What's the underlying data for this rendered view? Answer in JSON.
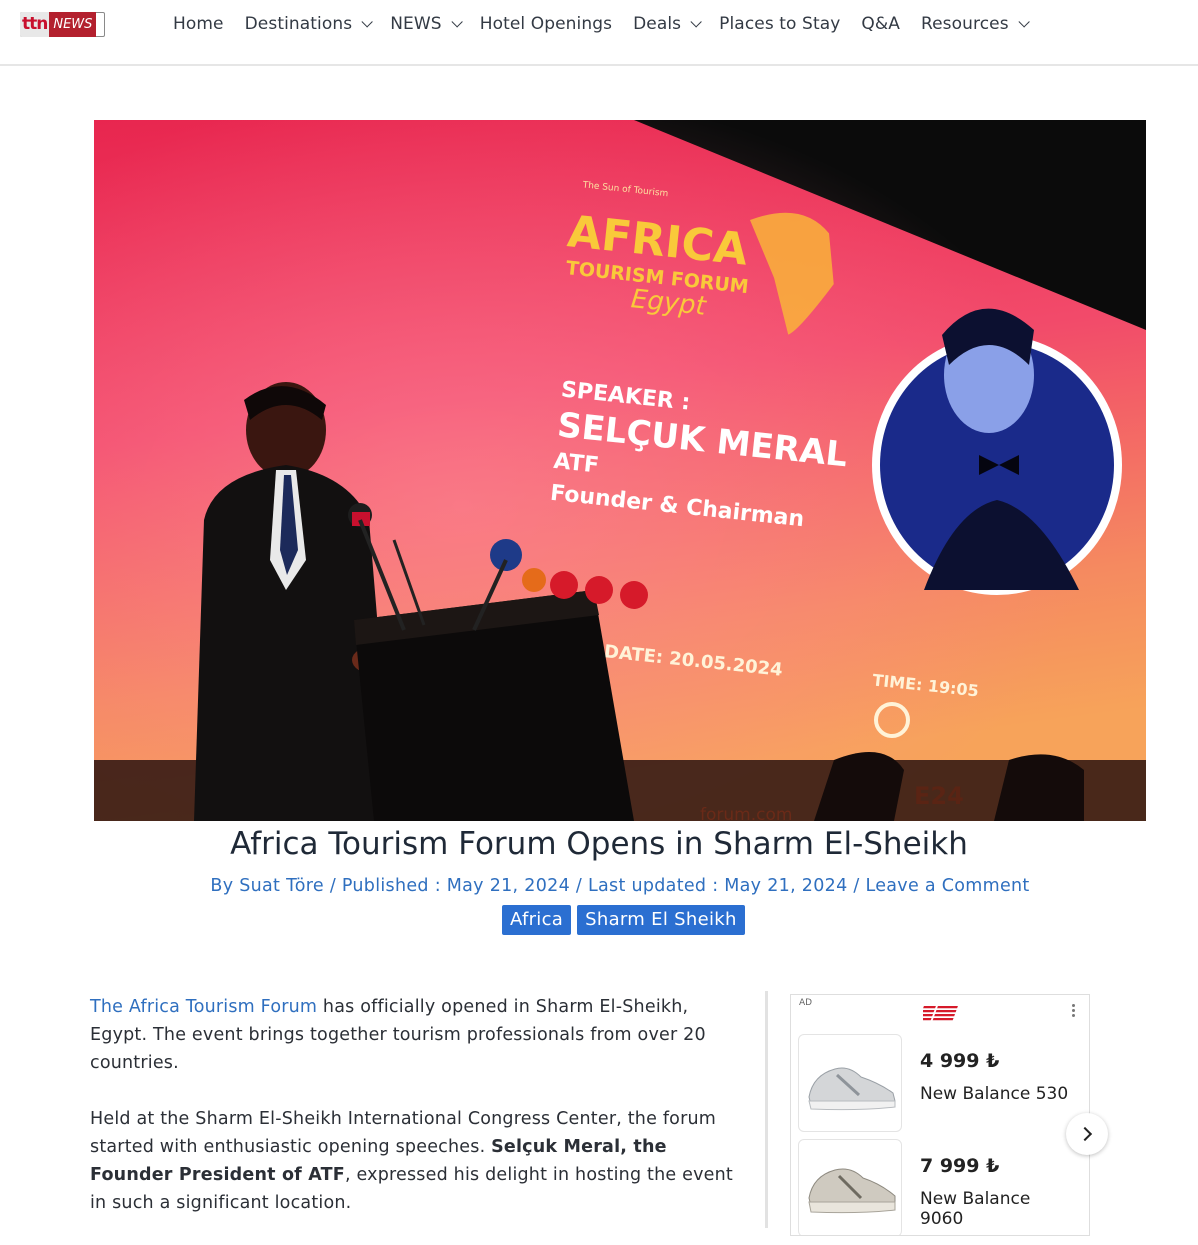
{
  "header": {
    "logo": {
      "part1": "ttn",
      "part2": "NEWS"
    },
    "nav": [
      {
        "label": "Home",
        "dropdown": false
      },
      {
        "label": "Destinations",
        "dropdown": true
      },
      {
        "label": "NEWS",
        "dropdown": true
      },
      {
        "label": "Hotel Openings",
        "dropdown": false
      },
      {
        "label": "Deals",
        "dropdown": true
      },
      {
        "label": "Places to Stay",
        "dropdown": false
      },
      {
        "label": "Q&A",
        "dropdown": false
      },
      {
        "label": "Resources",
        "dropdown": true
      }
    ]
  },
  "hero": {
    "screen_tagline": "The Sun of Tourism",
    "screen_brand": "AFRICA",
    "screen_brand_sub": "TOURISM FORUM",
    "screen_brand_script": "Egypt",
    "speaker_label": "SPEAKER :",
    "speaker_name": "SELÇUK MERAL",
    "speaker_org": "ATF",
    "speaker_role": "Founder & Chairman",
    "date_text": "DATE: 20.05.2024",
    "time_text": "TIME: 19:05",
    "footer_text": "forum.com",
    "year_text": "E24",
    "colors": {
      "screen_top": "#e8264f",
      "screen_mid": "#f24a6a",
      "screen_bottom": "#f7a35a"
    }
  },
  "article": {
    "title": "Africa Tourism Forum Opens in Sharm El-Sheikh",
    "meta": {
      "author": "By Suat Töre",
      "published": "Published : May 21, 2024",
      "updated": "Last updated : May 21, 2024",
      "comment": "Leave a Comment",
      "sep": " / "
    },
    "tags": [
      "Africa",
      "Sharm El Sheikh"
    ],
    "p1_link": "The Africa Tourism Forum",
    "p1_rest": " has officially opened in Sharm El-Sheikh, Egypt. The event brings together tourism professionals from over 20 countries.",
    "p2_start": "Held at the Sharm El-Sheikh International Congress Center, the forum started with enthusiastic opening speeches. ",
    "p2_bold": "Selçuk Meral, the Founder President of ATF",
    "p2_end": ", expressed his delight in hosting the event in such a significant location."
  },
  "ad": {
    "label": "AD",
    "brand_icon": "new-balance-logo",
    "products": [
      {
        "price": "4 999 ₺",
        "name": "New Balance 530"
      },
      {
        "price": "7 999 ₺",
        "name": "New Balance 9060"
      }
    ]
  }
}
